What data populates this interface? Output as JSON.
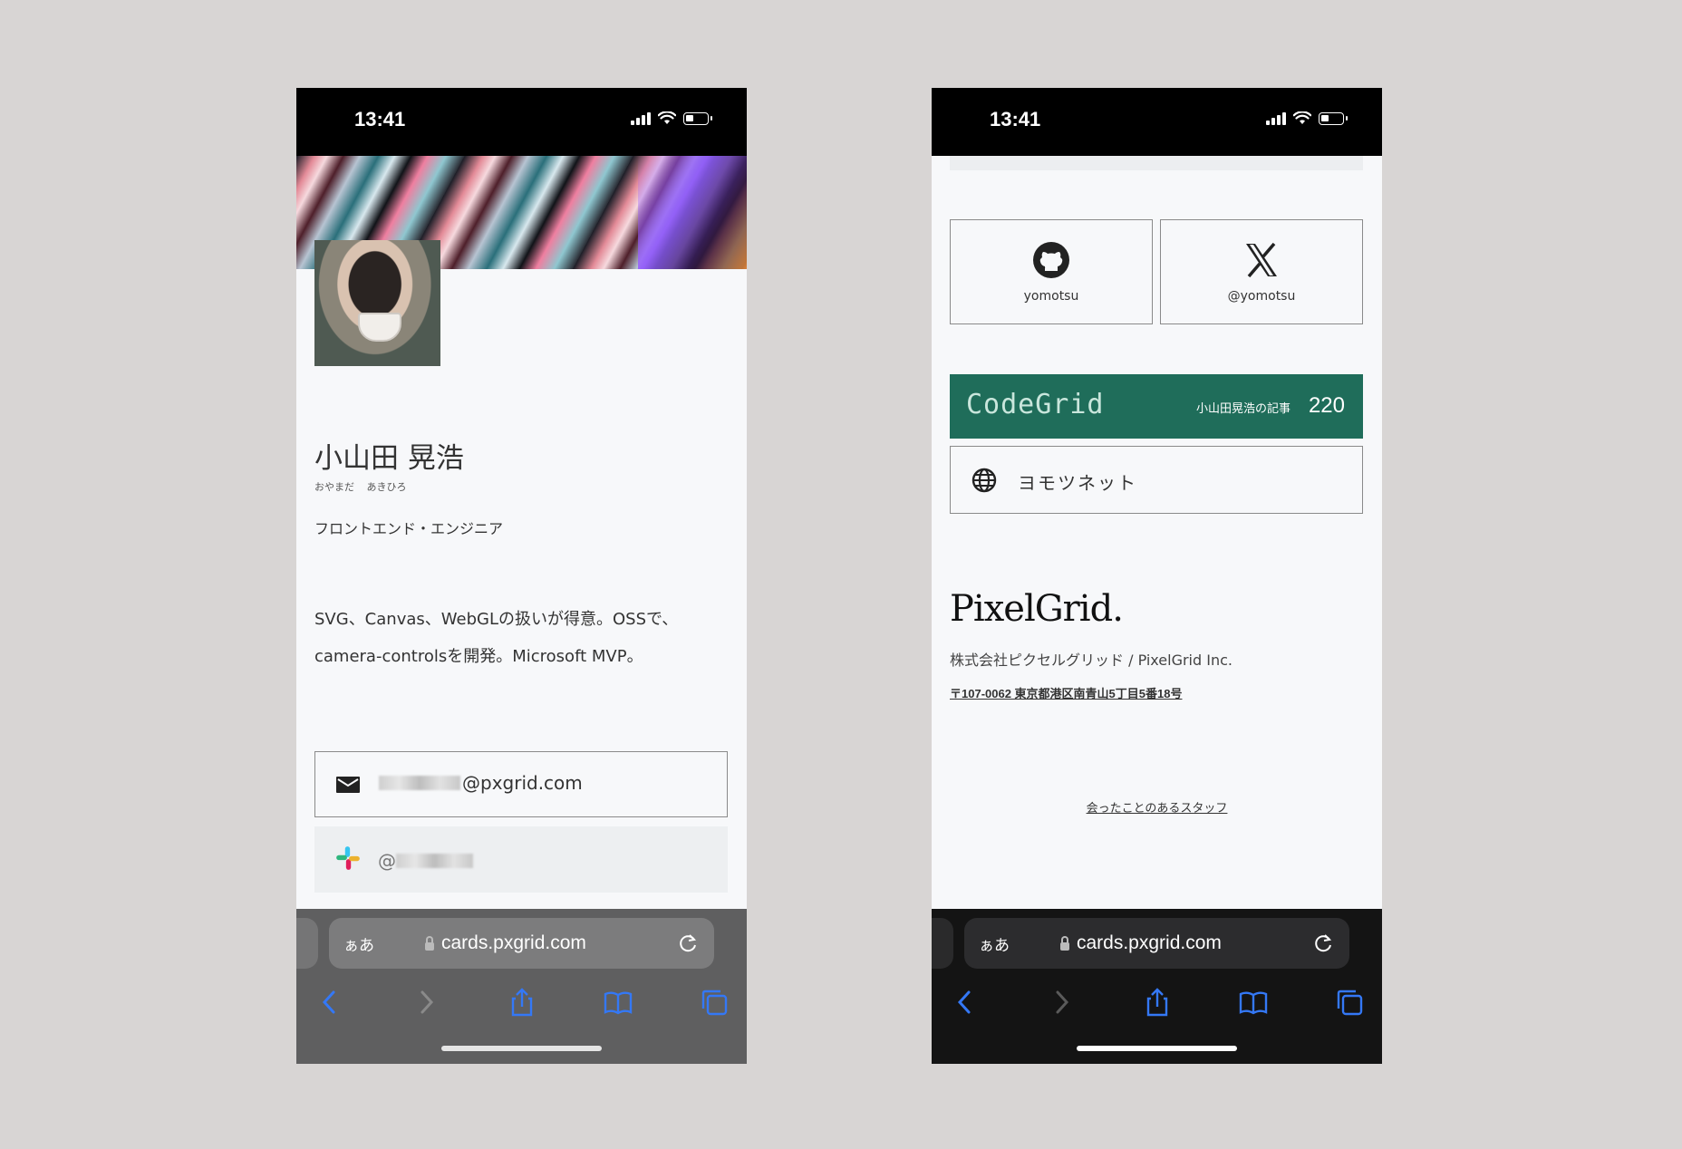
{
  "colors": {
    "background": "#d8d5d4",
    "page": "#f7f8fa",
    "codegrid_green": "#1f6d5a",
    "safari_tint": "#3478f6"
  },
  "left_phone": {
    "status": {
      "time": "13:41"
    },
    "profile": {
      "name": "小山田 晃浩",
      "kana": "おやまだ あきひろ",
      "role": "フロントエンド・エンジニア",
      "bio": "SVG、Canvas、WebGLの扱いが得意。OSSで、camera-controlsを開発。Microsoft MVP。"
    },
    "email": {
      "icon": "mail-icon",
      "domain": "@pxgrid.com"
    },
    "slack": {
      "icon": "slack-icon",
      "prefix": "@"
    },
    "browser": {
      "aa": "ぁあ",
      "url": "cards.pxgrid.com"
    }
  },
  "right_phone": {
    "status": {
      "time": "13:41"
    },
    "social": [
      {
        "icon": "github-icon",
        "label": "yomotsu"
      },
      {
        "icon": "x-icon",
        "label": "@yomotsu"
      }
    ],
    "codegrid": {
      "logo": "CodeGrid",
      "articles_label": "小山田晃浩の記事",
      "count": "220"
    },
    "website": {
      "icon": "globe-icon",
      "label": "ヨモツネット"
    },
    "company": {
      "logo": "PixelGrid.",
      "name": "株式会社ピクセルグリッド / PixelGrid Inc.",
      "address": "〒107-0062 東京都港区南青山5丁目5番18号"
    },
    "staff_link": "会ったことのあるスタッフ",
    "browser": {
      "aa": "ぁあ",
      "url": "cards.pxgrid.com"
    }
  }
}
